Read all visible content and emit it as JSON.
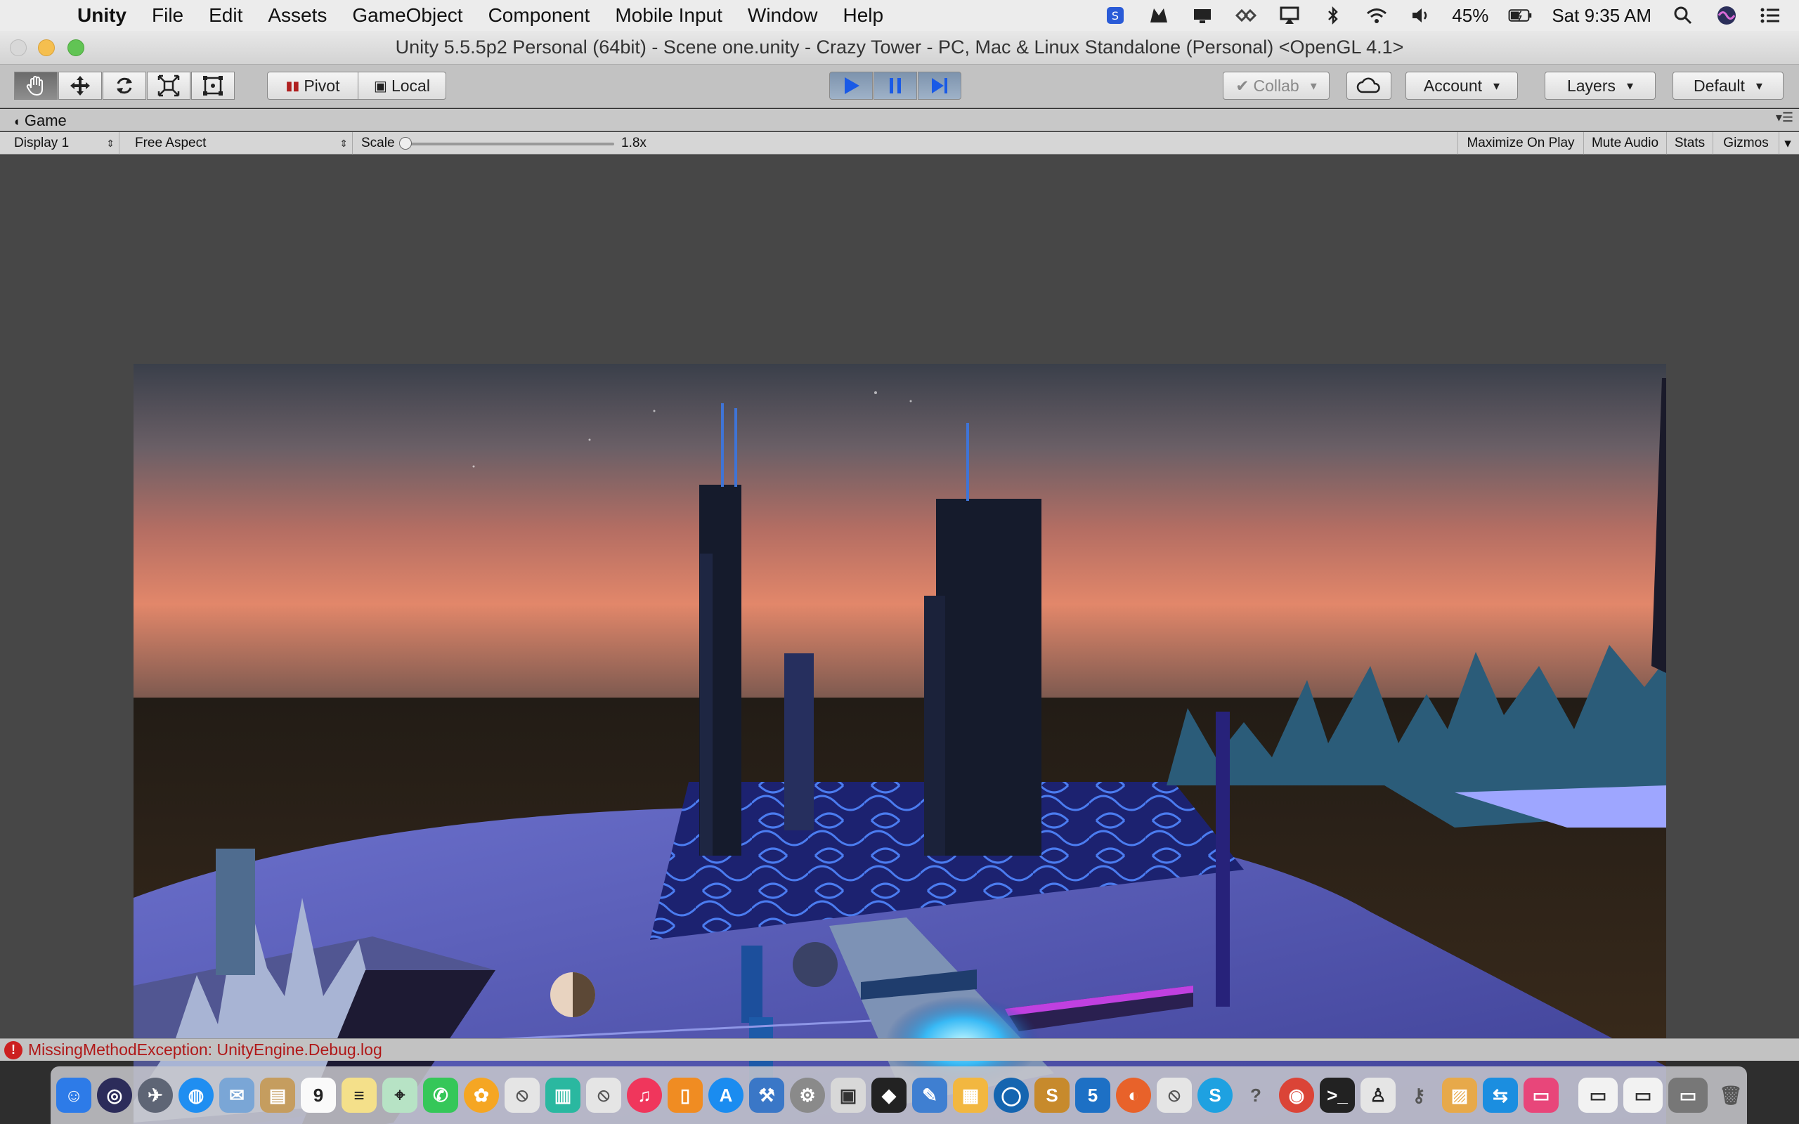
{
  "menubar": {
    "app_name": "Unity",
    "items": [
      "File",
      "Edit",
      "Assets",
      "GameObject",
      "Component",
      "Mobile Input",
      "Window",
      "Help"
    ],
    "battery": "45%",
    "clock": "Sat 9:35 AM"
  },
  "window": {
    "title": "Unity 5.5.5p2 Personal (64bit) - Scene one.unity - Crazy Tower - PC, Mac & Linux Standalone (Personal) <OpenGL 4.1>"
  },
  "toolbar": {
    "pivot_label": "Pivot",
    "local_label": "Local",
    "collab_label": "Collab",
    "account_label": "Account",
    "layers_label": "Layers",
    "layout_label": "Default"
  },
  "game_tab": {
    "label": "Game"
  },
  "game_view": {
    "display": "Display 1",
    "aspect": "Free Aspect",
    "scale_label": "Scale",
    "scale_value": "1.8x",
    "maximize_label": "Maximize On Play",
    "mute_label": "Mute Audio",
    "stats_label": "Stats",
    "gizmos_label": "Gizmos"
  },
  "console": {
    "message": "MissingMethodException: UnityEngine.Debug.log"
  },
  "colors": {
    "sky_top": "#3a3f4a",
    "sky_horizon": "#e2876a",
    "ground": "#2a2319",
    "floor": "#5a5fb8",
    "tower": "#151b2c"
  }
}
